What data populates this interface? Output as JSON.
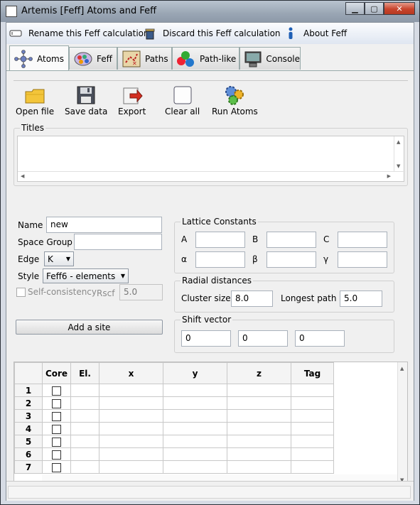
{
  "window": {
    "title": "Artemis [Feff] Atoms and Feff",
    "controls": [
      "minimize",
      "maximize",
      "close"
    ],
    "icon": "app-window-icon"
  },
  "menubar": {
    "items": [
      {
        "label": "Rename this Feff calculation",
        "icon": "rename-icon"
      },
      {
        "label": "Discard this Feff calculation",
        "icon": "trash-icon"
      },
      {
        "label": "About Feff",
        "icon": "info-icon"
      }
    ]
  },
  "tabs": [
    {
      "label": "Atoms",
      "icon": "atoms-icon",
      "active": true
    },
    {
      "label": "Feff",
      "icon": "feff-icon"
    },
    {
      "label": "Paths",
      "icon": "paths-icon"
    },
    {
      "label": "Path-like",
      "icon": "pathlike-icon"
    },
    {
      "label": "Console",
      "icon": "console-icon"
    }
  ],
  "toolbar": [
    {
      "label": "Open file",
      "icon": "folder-icon"
    },
    {
      "label": "Save data",
      "icon": "floppy-icon"
    },
    {
      "label": "Export",
      "icon": "export-icon"
    },
    {
      "label": "Clear all",
      "icon": "clear-icon"
    },
    {
      "label": "Run Atoms",
      "icon": "gears-icon"
    }
  ],
  "titles": {
    "label": "Titles",
    "value": ""
  },
  "form": {
    "name_label": "Name",
    "name_value": "new",
    "spacegroup_label": "Space Group",
    "spacegroup_value": "",
    "edge_label": "Edge",
    "edge_value": "K",
    "style_label": "Style",
    "style_value": "Feff6 - elements",
    "selfconsistency_label": "Self-consistency",
    "rscf_label": "Rscf",
    "rscf_value": "5.0",
    "add_site_label": "Add a site"
  },
  "lattice": {
    "label": "Lattice Constants",
    "a_label": "A",
    "b_label": "B",
    "c_label": "C",
    "alpha_label": "α",
    "beta_label": "β",
    "gamma_label": "γ",
    "a": "",
    "b": "",
    "c": "",
    "alpha": "",
    "beta": "",
    "gamma": ""
  },
  "radial": {
    "label": "Radial distances",
    "cluster_label": "Cluster size",
    "cluster_value": "8.0",
    "longest_label": "Longest path",
    "longest_value": "5.0"
  },
  "shift": {
    "label": "Shift vector",
    "values": [
      "0",
      "0",
      "0"
    ]
  },
  "sites_table": {
    "columns": [
      "Core",
      "El.",
      "x",
      "y",
      "z",
      "Tag"
    ],
    "rows": [
      "1",
      "2",
      "3",
      "4",
      "5",
      "6",
      "7"
    ]
  }
}
